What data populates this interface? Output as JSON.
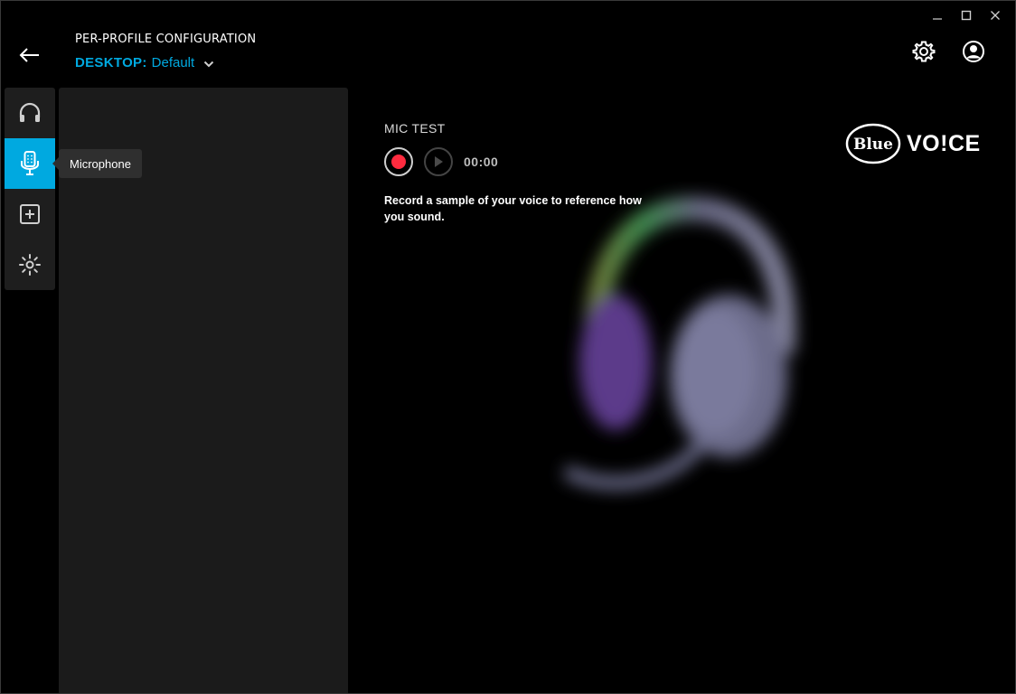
{
  "window": {
    "controls": [
      {
        "name": "minimize",
        "glyph": "—"
      },
      {
        "name": "maximize",
        "glyph": "☐"
      },
      {
        "name": "close",
        "glyph": "✕"
      }
    ]
  },
  "header": {
    "title": "PER-PROFILE CONFIGURATION",
    "profile": {
      "device": "DESKTOP:",
      "name": "Default"
    },
    "accent_color": "#00a9e0"
  },
  "sidebar": {
    "items": [
      {
        "id": "headphones",
        "icon": "headphones-icon",
        "active": false
      },
      {
        "id": "microphone",
        "icon": "microphone-icon",
        "active": true
      },
      {
        "id": "add",
        "icon": "plus-square-icon",
        "active": false
      },
      {
        "id": "lighting",
        "icon": "lighting-sun-icon",
        "active": false
      }
    ],
    "tooltip": "Microphone"
  },
  "mic_test": {
    "title": "MIC TEST",
    "timer": "00:00",
    "description": "Record a sample of your voice to reference how you sound.",
    "record_color": "#ff2b3f"
  },
  "logo": {
    "brand": "Blue",
    "product": "VO!CE"
  }
}
